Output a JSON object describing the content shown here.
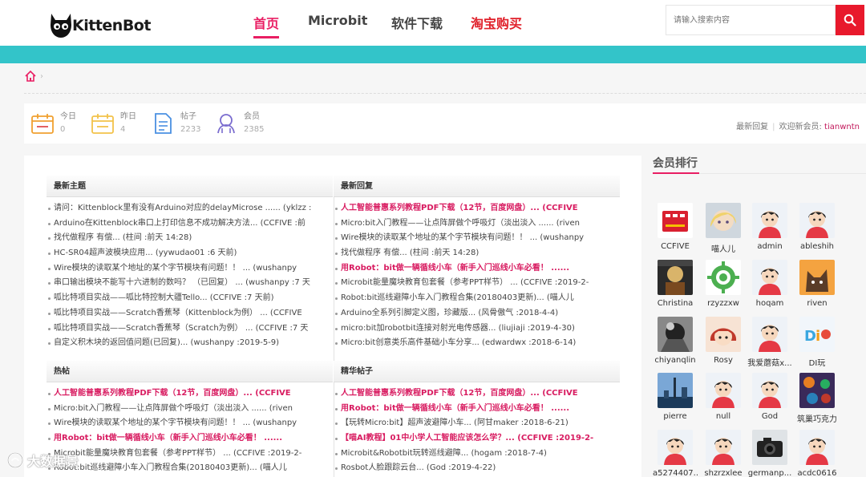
{
  "header": {
    "brand": "KittenBot",
    "nav": [
      {
        "label": "首页",
        "style": "active"
      },
      {
        "label": "Microbit",
        "style": "normal"
      },
      {
        "label": "软件下载",
        "style": "normal"
      },
      {
        "label": "淘宝购买",
        "style": "red"
      }
    ],
    "search_placeholder": "请输入搜索内容"
  },
  "stats": {
    "items": [
      {
        "label": "今日",
        "value": "0"
      },
      {
        "label": "昨日",
        "value": "4"
      },
      {
        "label": "帖子",
        "value": "2233"
      },
      {
        "label": "会员",
        "value": "2385"
      }
    ],
    "latest_reply": "最新回复",
    "welcome": "欢迎新会员:",
    "new_member": "tianwntn"
  },
  "sections": [
    {
      "title": "最新主题",
      "items": [
        {
          "text": "请问：Kittenblock里有没有Arduino对应的delayMicrose ...... (yklzz :",
          "hl": false
        },
        {
          "text": "Arduino在Kittenblock串口上打印信息不成功解决方法... (CCFIVE :前",
          "hl": false
        },
        {
          "text": "找代做程序 有偿... (柱间 :前天 14:28)",
          "hl": false
        },
        {
          "text": "HC-SR04超声波模块应用... (yywudao01 :6 天前)",
          "hl": false
        },
        {
          "text": "Wire模块的读取某个地址的某个字节模块有问题！！ ... (wushanpy",
          "hl": false
        },
        {
          "text": "串口输出模块不能写十六进制的数吗？ （已回复） ... (wushanpy :7 天",
          "hl": false
        },
        {
          "text": "呱比特项目实战——呱比特控制大疆Tello... (CCFIVE :7 天前)",
          "hl": false
        },
        {
          "text": "呱比特项目实战——Scratch香蕉琴（Kittenblock为例） ... (CCFIVE",
          "hl": false
        },
        {
          "text": "呱比特项目实战——Scratch香蕉琴（Scratch为例） ... (CCFIVE :7 天",
          "hl": false
        },
        {
          "text": "自定义积木块的返回值问题(已回复)... (wushanpy :2019-5-9)",
          "hl": false
        }
      ]
    },
    {
      "title": "最新回复",
      "items": [
        {
          "text": "人工智能普惠系列教程PDF下载（12节，百度网盘）... (CCFIVE",
          "hl": true
        },
        {
          "text": "Micro:bit入门教程——让点阵屏做个呼吸灯（淡出淡入 ...... (riven",
          "hl": false
        },
        {
          "text": "Wire模块的读取某个地址的某个字节模块有问题！！ ... (wushanpy",
          "hl": false
        },
        {
          "text": "找代做程序 有偿... (柱间 :前天 14:28)",
          "hl": false
        },
        {
          "text": "用Robot：bit做一辆循线小车（新手入门巡线小车必看！ ......",
          "hl": true
        },
        {
          "text": "Microbit能量魔块教育包套餐（参考PPT样节） ... (CCFIVE :2019-2-",
          "hl": false
        },
        {
          "text": "Robot:bit巡线避障小车入门教程合集(20180403更新)... (喵人儿",
          "hl": false
        },
        {
          "text": "Arduino全系列引脚定义图，珍藏版... (风骨傲气 :2018-4-4)",
          "hl": false
        },
        {
          "text": "micro:bit加robotbit连接对射光电传感器... (liujiaji :2019-4-30)",
          "hl": false
        },
        {
          "text": "Micro:bit创意类乐高件基础小车分享... (edwardwx :2018-6-14)",
          "hl": false
        }
      ]
    },
    {
      "title": "热帖",
      "items": [
        {
          "text": "人工智能普惠系列教程PDF下载（12节，百度网盘）... (CCFIVE",
          "hl": true
        },
        {
          "text": "Micro:bit入门教程——让点阵屏做个呼吸灯（淡出淡入 ...... (riven",
          "hl": false
        },
        {
          "text": "Wire模块的读取某个地址的某个字节模块有问题！！ ... (wushanpy",
          "hl": false
        },
        {
          "text": "用Robot：bit做一辆循线小车（新手入门巡线小车必看！ ......",
          "hl": true
        },
        {
          "text": "Microbit能量魔块教育包套餐（参考PPT样节） ... (CCFIVE :2019-2-",
          "hl": false
        },
        {
          "text": "Robot:bit巡线避障小车入门教程合集(20180403更新)... (喵人儿",
          "hl": false
        }
      ]
    },
    {
      "title": "精华帖子",
      "items": [
        {
          "text": "人工智能普惠系列教程PDF下载（12节，百度网盘）... (CCFIVE",
          "hl": true
        },
        {
          "text": "用Robot：bit做一辆循线小车（新手入门巡线小车必看！ ......",
          "hl": true
        },
        {
          "text": "【玩转Micro:bit】超声波避障小车... (阿甘maker :2018-6-21)",
          "hl": false
        },
        {
          "text": "【喵AI教程】01中小学人工智能应该怎么学？... (CCFIVE :2019-2-",
          "hl": true
        },
        {
          "text": "Microbit&Robotbit玩转巡线避障... (hogam :2018-7-4)",
          "hl": false
        },
        {
          "text": "Rosbot人脸跟踪云台... (God :2019-4-22)",
          "hl": false
        }
      ]
    }
  ],
  "ranking": {
    "title": "会员排行",
    "members": [
      {
        "name": "CCFIVE",
        "avatar": "board"
      },
      {
        "name": "喵人儿",
        "avatar": "anime"
      },
      {
        "name": "admin",
        "avatar": "default"
      },
      {
        "name": "ableshih",
        "avatar": "default"
      },
      {
        "name": "Christina",
        "avatar": "painting"
      },
      {
        "name": "rzyzzxw",
        "avatar": "gear"
      },
      {
        "name": "hoqam",
        "avatar": "default"
      },
      {
        "name": "riven",
        "avatar": "cat"
      },
      {
        "name": "chiyanqlin",
        "avatar": "bw"
      },
      {
        "name": "Rosy",
        "avatar": "girl"
      },
      {
        "name": "我爱蘑菇x...",
        "avatar": "default"
      },
      {
        "name": "DI玩",
        "avatar": "di"
      },
      {
        "name": "pierre",
        "avatar": "city"
      },
      {
        "name": "null",
        "avatar": "default"
      },
      {
        "name": "God",
        "avatar": "default"
      },
      {
        "name": "筑巢巧克力",
        "avatar": "pattern"
      },
      {
        "name": "a5274407...",
        "avatar": "default"
      },
      {
        "name": "shzrzxlee",
        "avatar": "default"
      },
      {
        "name": "germanp...",
        "avatar": "camera"
      },
      {
        "name": "acdc0616",
        "avatar": "default"
      }
    ]
  },
  "watermark": "大数据景"
}
